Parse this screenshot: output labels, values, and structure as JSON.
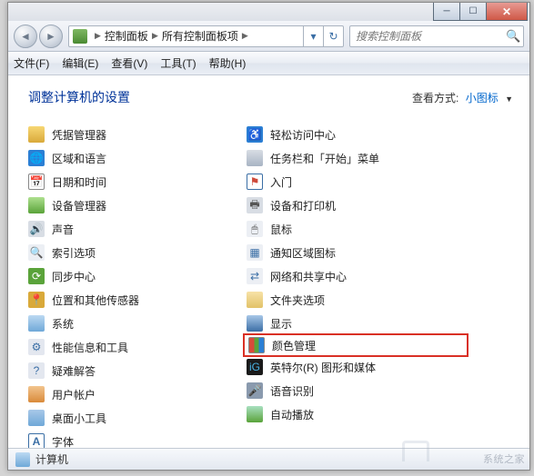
{
  "breadcrumb": {
    "seg1": "控制面板",
    "seg2": "所有控制面板项"
  },
  "search": {
    "placeholder": "搜索控制面板"
  },
  "menu": {
    "file": "文件(F)",
    "edit": "编辑(E)",
    "view": "查看(V)",
    "tools": "工具(T)",
    "help": "帮助(H)"
  },
  "header": {
    "title": "调整计算机的设置",
    "viewby_label": "查看方式:",
    "viewby_value": "小图标"
  },
  "left": [
    {
      "name": "credential-manager",
      "label": "凭据管理器"
    },
    {
      "name": "region-language",
      "label": "区域和语言"
    },
    {
      "name": "date-time",
      "label": "日期和时间"
    },
    {
      "name": "device-manager",
      "label": "设备管理器"
    },
    {
      "name": "sound",
      "label": "声音"
    },
    {
      "name": "indexing-options",
      "label": "索引选项"
    },
    {
      "name": "sync-center",
      "label": "同步中心"
    },
    {
      "name": "location-sensors",
      "label": "位置和其他传感器"
    },
    {
      "name": "system",
      "label": "系统"
    },
    {
      "name": "performance-info",
      "label": "性能信息和工具"
    },
    {
      "name": "troubleshooting",
      "label": "疑难解答"
    },
    {
      "name": "user-accounts",
      "label": "用户帐户"
    },
    {
      "name": "desktop-gadgets",
      "label": "桌面小工具"
    },
    {
      "name": "fonts",
      "label": "字体"
    }
  ],
  "right": [
    {
      "name": "ease-of-access",
      "label": "轻松访问中心"
    },
    {
      "name": "taskbar-start",
      "label": "任务栏和「开始」菜单"
    },
    {
      "name": "getting-started",
      "label": "入门"
    },
    {
      "name": "devices-printers",
      "label": "设备和打印机"
    },
    {
      "name": "mouse",
      "label": "鼠标"
    },
    {
      "name": "notification-area",
      "label": "通知区域图标"
    },
    {
      "name": "network-sharing",
      "label": "网络和共享中心"
    },
    {
      "name": "folder-options",
      "label": "文件夹选项"
    },
    {
      "name": "display",
      "label": "显示"
    },
    {
      "name": "color-management",
      "label": "颜色管理"
    },
    {
      "name": "intel-graphics",
      "label": "英特尔(R) 图形和媒体"
    },
    {
      "name": "speech-recognition",
      "label": "语音识别"
    },
    {
      "name": "autoplay",
      "label": "自动播放"
    }
  ],
  "statusbar": {
    "label": "计算机"
  },
  "highlighted": "color-management"
}
